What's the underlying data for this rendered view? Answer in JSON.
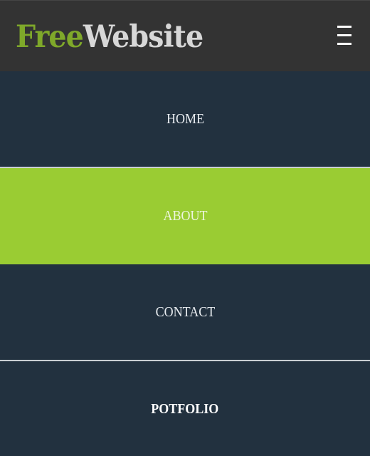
{
  "header": {
    "logo_part1": "Free",
    "logo_part2": "Website"
  },
  "icons": {
    "menu": "hamburger-menu-icon"
  },
  "colors": {
    "header_bg": "#333333",
    "nav_bg": "#22313f",
    "accent": "#9acc33",
    "logo_free": "#7fa82a",
    "logo_website": "#d7d7d7"
  },
  "nav": {
    "items": [
      {
        "label": "HOME"
      },
      {
        "label": "ABOUT"
      },
      {
        "label": "CONTACT"
      },
      {
        "label": "POTFOLIO"
      }
    ]
  }
}
